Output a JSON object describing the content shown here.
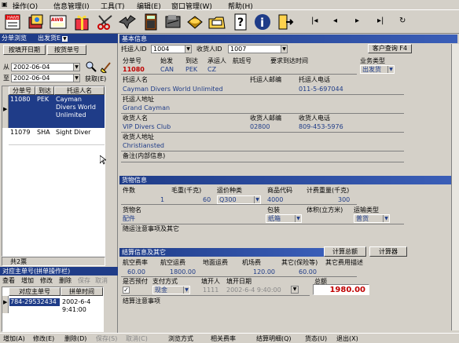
{
  "menu": {
    "ops": "操作(O)",
    "info": "信息管理(I)",
    "tools": "工具(T)",
    "edit": "编辑(E)",
    "window": "窗口管理(W)",
    "help": "帮助(H)"
  },
  "toolbar_icons": [
    "hawb-doc-icon",
    "book-icon",
    "awb-icon",
    "gift-icon",
    "scissors-icon",
    "eagle-icon",
    "calculator-icon",
    "stamp-icon",
    "phone-icon",
    "folder-icon",
    "question-icon",
    "info-icon",
    "exit-door-icon"
  ],
  "toolbar_text": {
    "hawb": "HAWB",
    "awb": "AWB"
  },
  "nav": {
    "first": "|◂",
    "prev": "◂",
    "next": "▸",
    "last": "▸|",
    "refresh": "↻"
  },
  "left": {
    "browse_header": "分单浏览",
    "combo": "出发货E",
    "tab1": "按填开日期",
    "tab2": "按货单号",
    "from_label": "从",
    "from_date": "2002-06-04",
    "to_label": "至",
    "to_date": "2002-06-04",
    "fetch": "获取(E)",
    "cols": [
      "分单号",
      "到达",
      "托运人名"
    ],
    "rows": [
      {
        "no": "11080",
        "dest": "PEK",
        "name": "Cayman Divers World Unlimited",
        "sel": true
      },
      {
        "no": "11079",
        "dest": "SHA",
        "name": "Sight Diver",
        "sel": false
      }
    ],
    "count": "共2票",
    "master_header": "对应主单号(拼单操作栏)",
    "mtools": [
      "查看",
      "增加",
      "修改",
      "删除",
      "保存",
      "取消"
    ],
    "mcols": [
      "对应主单号",
      "拼单时间"
    ],
    "mrow": {
      "no": "784-29532434",
      "time": "2002-6-4 9:41:00"
    }
  },
  "basic": {
    "header": "基本信息",
    "shipper_id_label": "托运人ID",
    "shipper_id": "1004",
    "consignee_id_label": "收货人ID",
    "consignee_id": "1007",
    "cust_query": "客户查询 F4",
    "hdr": [
      "分单号",
      "始发",
      "到达",
      "承运人",
      "航班号",
      "要求到达时间",
      "业务类型"
    ],
    "no": "11080",
    "orig": "CAN",
    "dest": "PEK",
    "carrier": "CZ",
    "biztype": "出发货",
    "shipper_name_label": "托运人名",
    "shipper_zip_label": "托运人邮编",
    "shipper_phone_label": "托运人电话",
    "shipper_name": "Cayman Divers World Unlimited",
    "shipper_phone": "011-5-697044",
    "shipper_addr_label": "托运人地址",
    "shipper_addr": "Grand Cayman",
    "consignee_name_label": "收货人名",
    "consignee_zip_label": "收货人邮编",
    "consignee_phone_label": "收货人电话",
    "consignee_name": "VIP Divers Club",
    "consignee_zip": "02800",
    "consignee_phone": "809-453-5976",
    "consignee_addr_label": "收货人地址",
    "consignee_addr": "Christiansted",
    "remark_label": "备注(内部信息)"
  },
  "cargo": {
    "header": "货物信息",
    "labels": [
      "件数",
      "毛重(千克)",
      "运价种类",
      "商品代码",
      "计费重量(千克)"
    ],
    "pieces": "1",
    "weight": "60",
    "rate_class": "Q300",
    "code": "4000",
    "chg_weight": "300",
    "name_label": "货物名",
    "name": "配件",
    "pack_label": "包装",
    "pack": "纸箱",
    "vol_label": "体积(立方米)",
    "ship_label": "运输类型",
    "ship": "普货",
    "notes_label": "随运注意事项及其它"
  },
  "settle": {
    "header": "结算信息及其它",
    "calc_total": "计算总额",
    "calculator": "计算器",
    "labels": [
      "航空费率",
      "航空运费",
      "地面运费",
      "机场费",
      "其它(保险等)",
      "其它费用描述"
    ],
    "rate": "60.00",
    "freight": "1800.00",
    "airport": "120.00",
    "other": "60.00",
    "prepaid_label": "是否预付",
    "pay_label": "支付方式",
    "filler_label": "填开人",
    "fill_date_label": "填开日期",
    "total_label": "总额",
    "pay": "现金",
    "filler": "1111",
    "fill_date": "2002-6-4 9:40:00",
    "total": "1980.00",
    "notes_label": "结算注意事项"
  },
  "statusbar": [
    "增加(A)",
    "修改(E)",
    "删除(D)",
    "保存(S)",
    "取消(C)",
    "浏览方式",
    "相关费率",
    "结算明细(Q)",
    "货态(U)",
    "退出(X)"
  ]
}
